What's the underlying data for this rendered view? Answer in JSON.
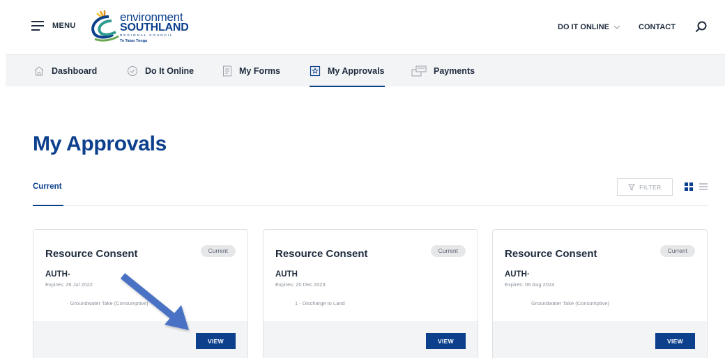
{
  "header": {
    "menu_label": "MENU",
    "logo": {
      "line1": "environment",
      "line2": "SOUTHLAND",
      "line3": "REGIONAL COUNCIL",
      "line4": "Te Taiao Tonga"
    },
    "do_it_online_label": "DO IT ONLINE",
    "contact_label": "CONTACT"
  },
  "subnav": {
    "items": [
      {
        "label": "Dashboard",
        "icon": "home-icon"
      },
      {
        "label": "Do It Online",
        "icon": "check-circle-icon"
      },
      {
        "label": "My Forms",
        "icon": "document-icon"
      },
      {
        "label": "My Approvals",
        "icon": "star-badge-icon",
        "active": true
      },
      {
        "label": "Payments",
        "icon": "payment-icon"
      }
    ]
  },
  "page": {
    "title": "My Approvals",
    "tab_current": "Current",
    "filter_label": "FILTER"
  },
  "cards": [
    {
      "title": "Resource Consent",
      "status": "Current",
      "ref": "AUTH-",
      "expires": "Expires: 26 Jul 2022",
      "description": "· Groundwater Take (Consumptive)",
      "view_label": "VIEW"
    },
    {
      "title": "Resource Consent",
      "status": "Current",
      "ref": "AUTH",
      "expires": "Expires: 20 Dec 2023",
      "description": "1 - Discharge to Land",
      "view_label": "VIEW"
    },
    {
      "title": "Resource Consent",
      "status": "Current",
      "ref": "AUTH·",
      "expires": "Expires: 06 Aug 2024",
      "description": "Groundwater Take (Consumptive)",
      "view_label": "VIEW"
    }
  ],
  "colors": {
    "brand": "#0c3f8c",
    "annotation_arrow": "#4a72c4",
    "subnav_bg": "#f3f4f6"
  }
}
